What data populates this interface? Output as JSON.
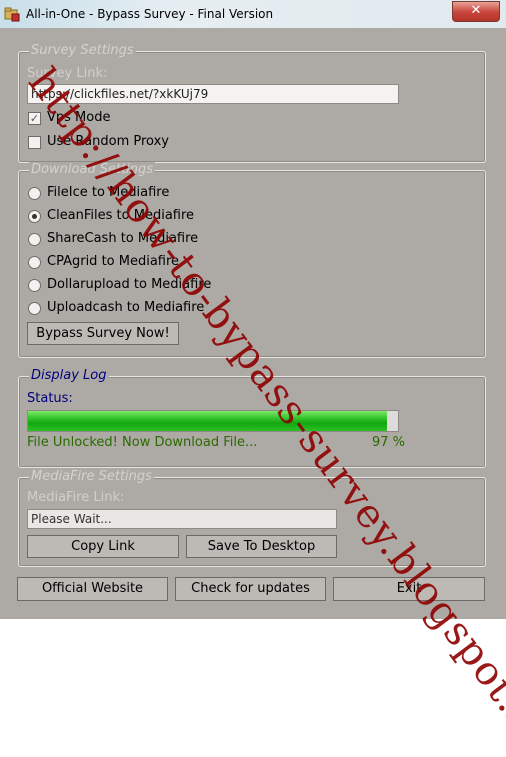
{
  "window": {
    "title": "All-in-One - Bypass Survey - Final Version",
    "close_label": "✕",
    "icon": "folder-lock-icon"
  },
  "survey_settings": {
    "legend": "Survey Settings",
    "link_label": "Survey Link:",
    "link_value": "https://clickfiles.net/?xkKUj79",
    "vps_mode_label": "Vps Mode",
    "vps_mode_checked": true,
    "random_proxy_label": "Use Random Proxy",
    "random_proxy_checked": false
  },
  "download_settings": {
    "legend": "Download Settings",
    "options": [
      {
        "label": "FileIce to Mediafire",
        "selected": false
      },
      {
        "label": "CleanFiles to Mediafire",
        "selected": true
      },
      {
        "label": "ShareCash to Mediafire",
        "selected": false
      },
      {
        "label": "CPAgrid to Mediafire",
        "selected": false
      },
      {
        "label": "Dollarupload to Mediafire",
        "selected": false
      },
      {
        "label": "Uploadcash to Mediafire",
        "selected": false
      }
    ],
    "bypass_button": "Bypass Survey Now!"
  },
  "display_log": {
    "legend": "Display Log",
    "status_label": "Status:",
    "progress_fraction": 0.97,
    "status_message": "File Unlocked! Now Download File...",
    "percent_text": "97 %"
  },
  "mediafire_settings": {
    "legend": "MediaFire Settings",
    "link_label": "MediaFire Link:",
    "link_value": "Please Wait...",
    "copy_button": "Copy Link",
    "save_button": "Save To Desktop"
  },
  "footer": {
    "website_button": "Official Website",
    "updates_button": "Check for updates",
    "exit_button": "Exit"
  },
  "watermark": "http://how-to-bypass-survey.blogspot.it/",
  "colors": {
    "accent_legend": "#00007e",
    "status_text": "#2a6a00",
    "progress": "#12a710",
    "watermark": "#8e0000"
  }
}
